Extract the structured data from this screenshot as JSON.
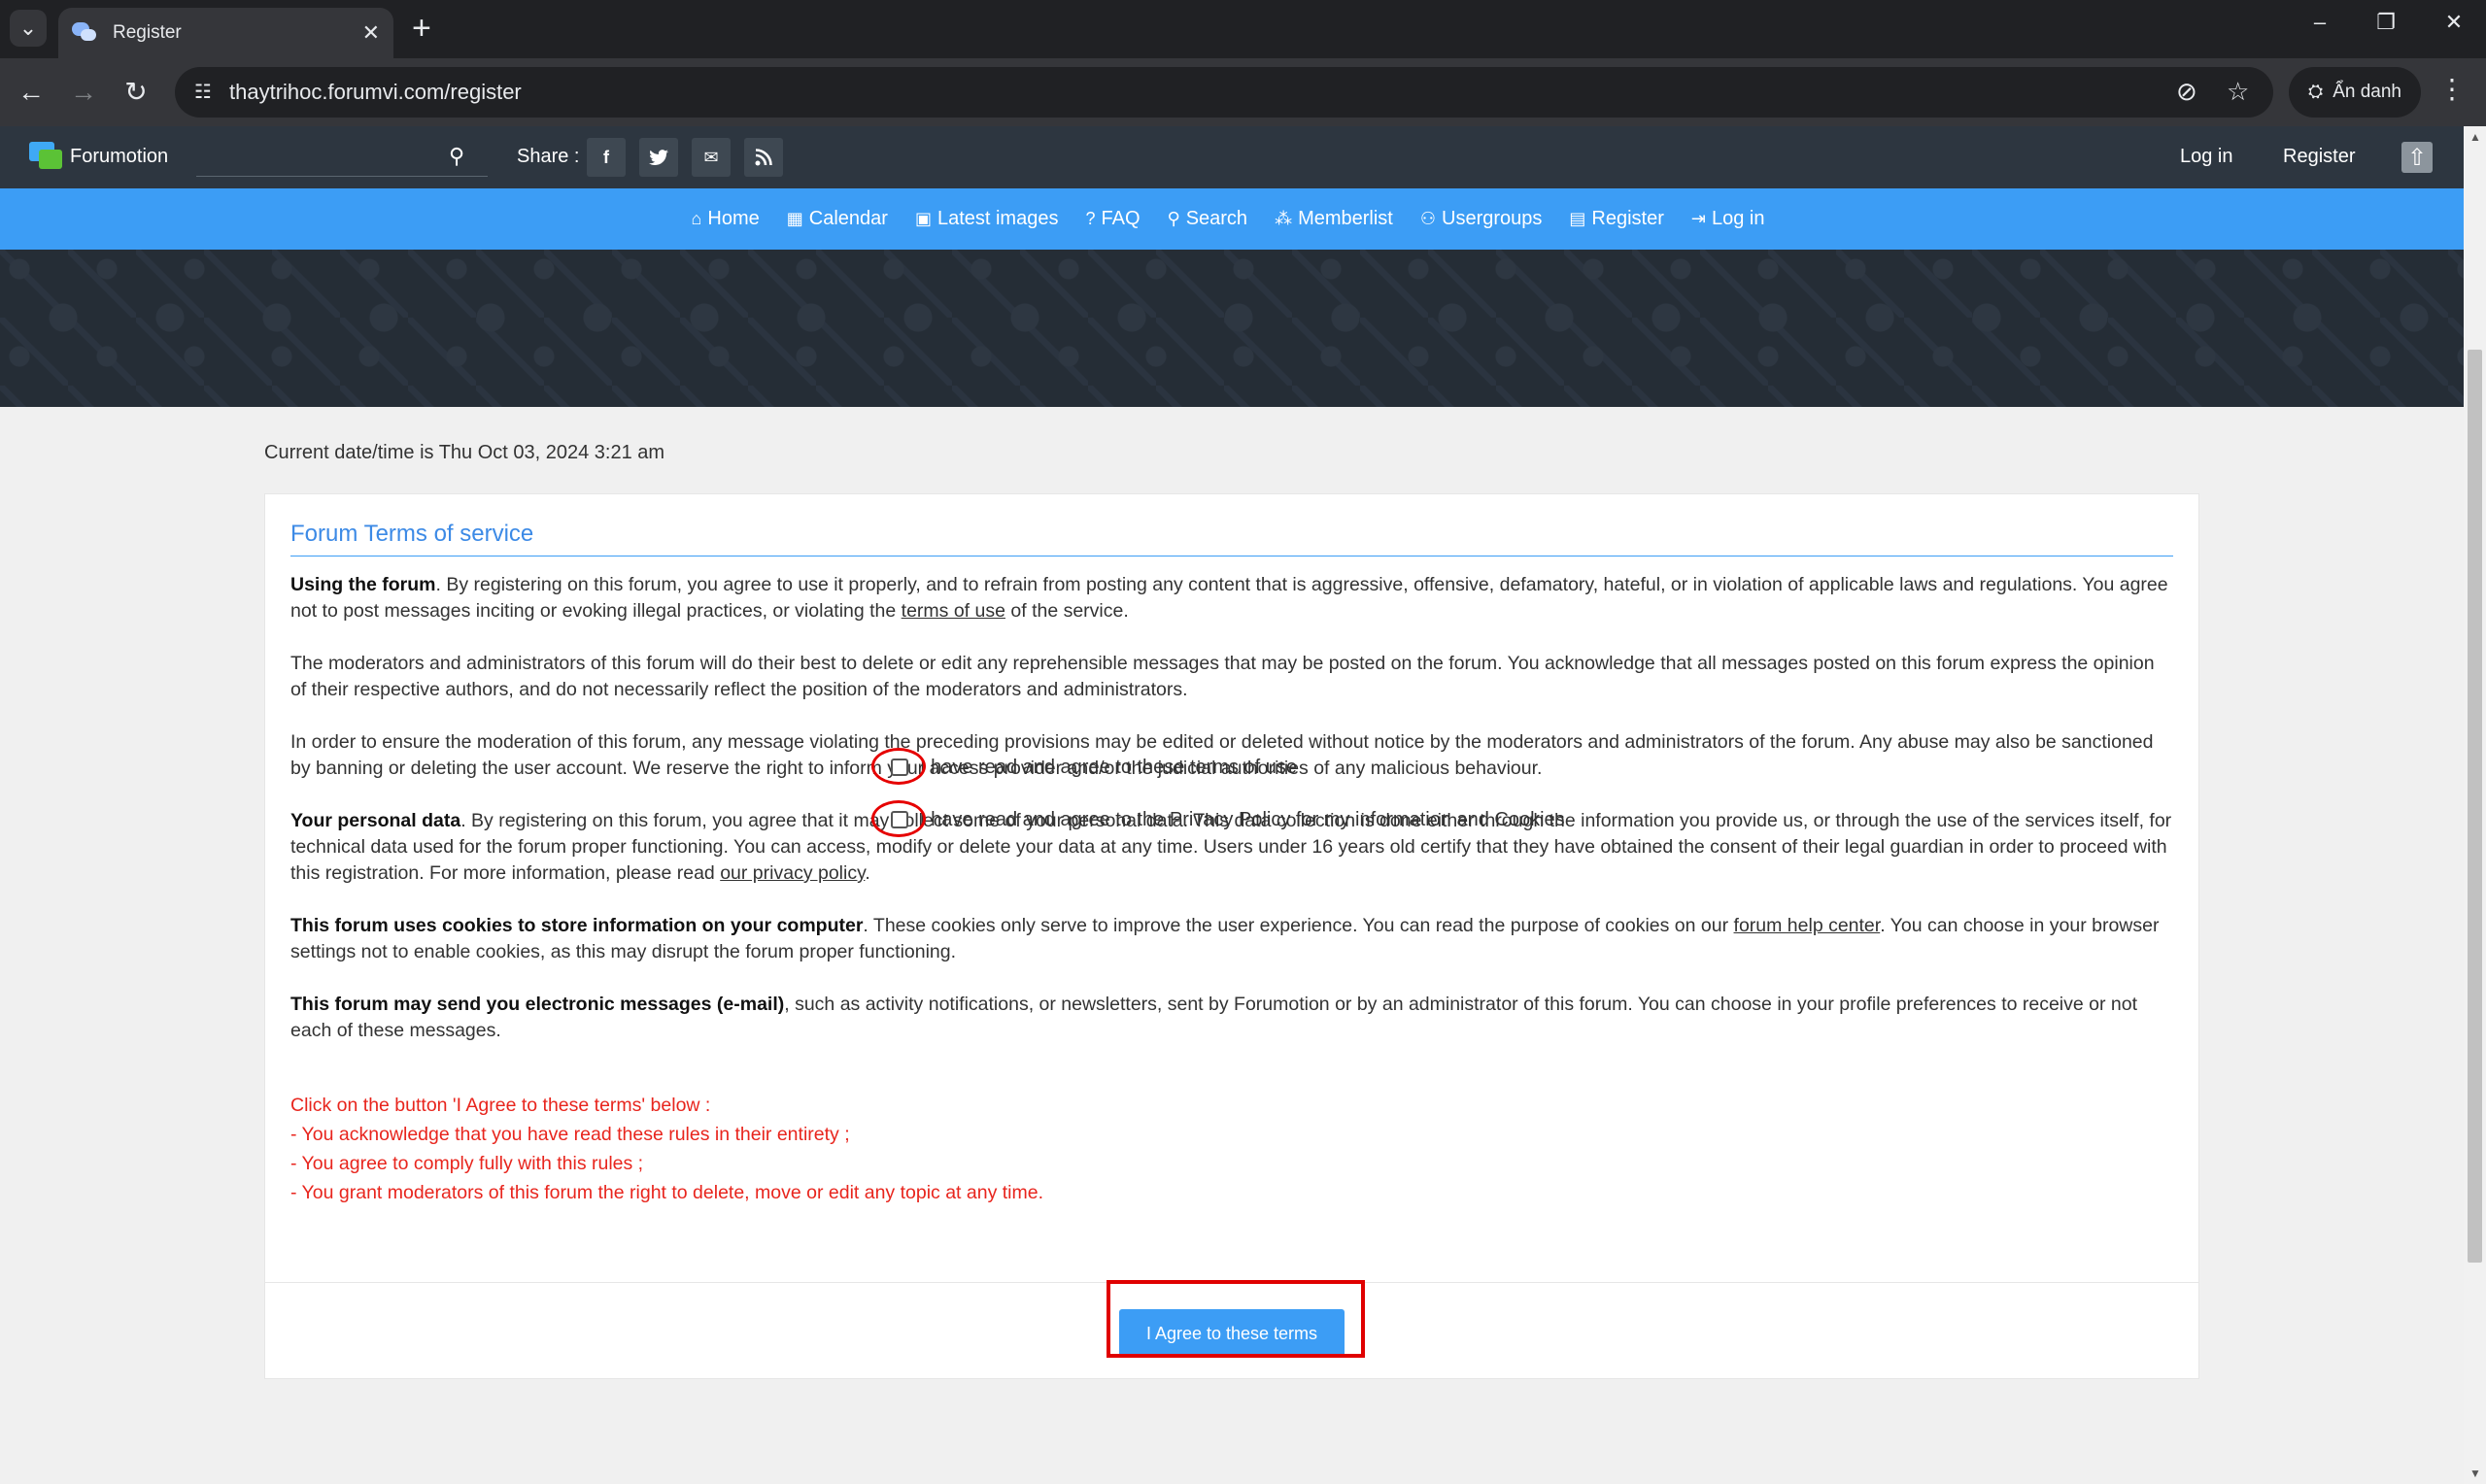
{
  "browser": {
    "tab_title": "Register",
    "tab_menu_icon": "chevron-down",
    "close_tab": "✕",
    "new_tab": "+",
    "minimize": "–",
    "restore": "❐",
    "close_window": "✕",
    "back": "←",
    "forward": "→",
    "reload": "↻",
    "url": "thaytrihoc.forumvi.com/register",
    "incognito_label": "Ẩn danh",
    "menu": "⋮"
  },
  "topbar": {
    "brand": "Forumotion",
    "search_placeholder": "",
    "share_label": "Share :",
    "share_buttons": [
      "f",
      "t",
      "✉",
      "rss"
    ],
    "login": "Log in",
    "register": "Register"
  },
  "nav": {
    "items": [
      {
        "label": "Home",
        "icon": "⌂"
      },
      {
        "label": "Calendar",
        "icon": "▦"
      },
      {
        "label": "Latest images",
        "icon": "▣"
      },
      {
        "label": "FAQ",
        "icon": "?"
      },
      {
        "label": "Search",
        "icon": "⚲"
      },
      {
        "label": "Memberlist",
        "icon": "⁂"
      },
      {
        "label": "Usergroups",
        "icon": "⚇"
      },
      {
        "label": "Register",
        "icon": "▤"
      },
      {
        "label": "Log in",
        "icon": "⇥"
      }
    ]
  },
  "main": {
    "datetime": "Current date/time is Thu Oct 03, 2024 3:21 am",
    "panel_title": "Forum Terms of service",
    "p1_bold": "Using the forum",
    "p1_text": ". By registering on this forum, you agree to use it properly, and to refrain from posting any content that is aggressive, offensive, defamatory, hateful, or in violation of applicable laws and regulations. You agree not to post messages inciting or evoking illegal practices, or violating the ",
    "p1_link": "terms of use",
    "p1_end": " of the service.",
    "p2": "The moderators and administrators of this forum will do their best to delete or edit any reprehensible messages that may be posted on the forum. You acknowledge that all messages posted on this forum express the opinion of their respective authors, and do not necessarily reflect the position of the moderators and administrators.",
    "p3": "In order to ensure the moderation of this forum, any message violating the preceding provisions may be edited or deleted without notice by the moderators and administrators of the forum. Any abuse may also be sanctioned by banning or deleting the user account. We reserve the right to inform your access provider and/or the judicial authorities of any malicious behaviour.",
    "p4_bold": "Your personal data",
    "p4_text": ". By registering on this forum, you agree that it may collect some of your personal data. This data collection is done either through the information you provide us, or through the use of the services itself, for technical data used for the forum proper functioning. You can access, modify or delete your data at any time. Users under 16 years old certify that they have obtained the consent of their legal guardian in order to proceed with this registration. For more information, please read ",
    "p4_link": "our privacy policy",
    "p4_end": ".",
    "p5_bold": "This forum uses cookies to store information on your computer",
    "p5_text": ". These cookies only serve to improve the user experience. You can read the purpose of cookies on our ",
    "p5_link": "forum help center",
    "p5_end": ". You can choose in your browser settings not to enable cookies, as this may disrupt the forum proper functioning.",
    "p6_bold": "This forum may send you electronic messages (e-mail)",
    "p6_text": ", such as activity notifications, or newsletters, sent by Forumotion or by an administrator of this forum. You can choose in your profile preferences to receive or not each of these messages.",
    "rules": [
      "Click on the button 'I Agree to these terms' below :",
      "- You acknowledge that you have read these rules in their entirety ;",
      "- You agree to comply fully with this rules ;",
      "- You grant moderators of this forum the right to delete, move or edit any topic at any time."
    ],
    "check_terms": "I have read and agree to these terms of use",
    "check_privacy": "I have read and agree to the Privacy Policy for my information and Cookies",
    "check_terms_checked": false,
    "check_privacy_checked": false,
    "agree_button": "I Agree to these terms"
  },
  "colors": {
    "accent": "#3c9df5",
    "topbar": "#2d3640",
    "warning_text": "#e8251d",
    "highlight": "#e00000"
  }
}
